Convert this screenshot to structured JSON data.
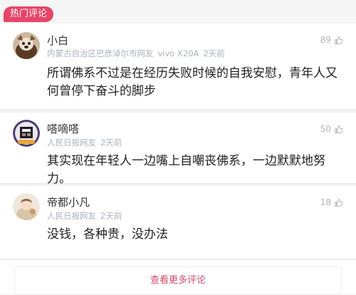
{
  "section": {
    "title": "热门评论"
  },
  "comments": [
    {
      "username": "小白",
      "meta": [
        "内蒙古自治区巴彦淖尔市网友",
        "vivo X20A",
        "2天前"
      ],
      "likes": "89",
      "text": "所谓佛系不过是在经历失败时候的自我安慰，青年人又何曾停下奋斗的脚步"
    },
    {
      "username": "嗒嘀嗒",
      "meta": [
        "人民日报网友",
        "2天前"
      ],
      "likes": "50",
      "text": "其实现在年轻人一边嘴上自嘲丧佛系，一边默默地努力。"
    },
    {
      "username": "帝都小凡",
      "meta": [
        "人民日报网友",
        "2天前"
      ],
      "likes": "18",
      "text": "没钱，各种贵，没办法"
    }
  ],
  "more_button": {
    "label": "查看更多评论"
  },
  "colors": {
    "accent": "#e64468",
    "meta": "#aab3be",
    "like": "#b4b4b4"
  }
}
